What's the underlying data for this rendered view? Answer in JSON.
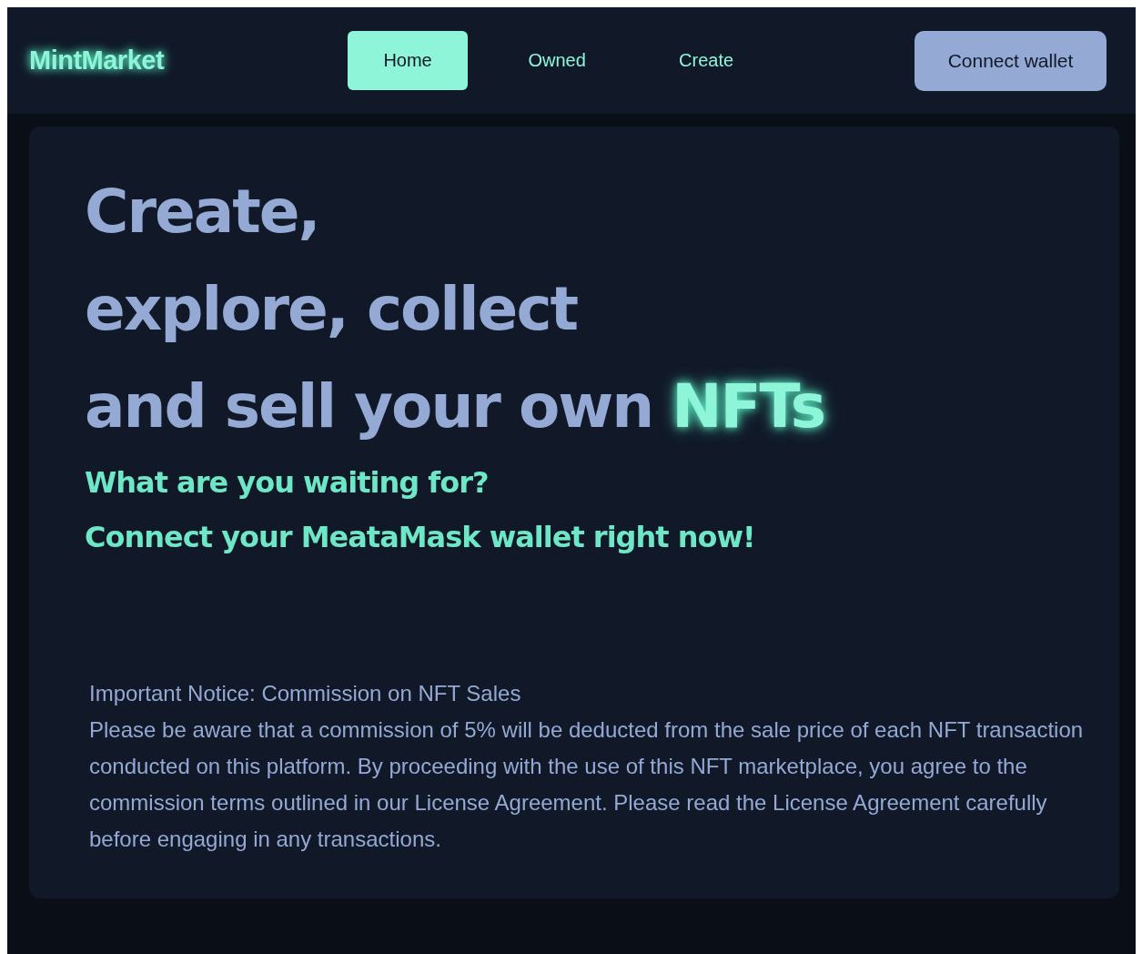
{
  "brand": "MintMarket",
  "nav": [
    {
      "label": "Home",
      "selected": true
    },
    {
      "label": "Owned",
      "selected": false
    },
    {
      "label": "Create",
      "selected": false
    }
  ],
  "connect_button": "Connect wallet",
  "headline": {
    "lines": [
      "Create,",
      "explore, collect",
      "and sell your own"
    ],
    "highlight": "NFTs"
  },
  "subheadings": [
    "What are you waiting for?",
    "Connect your MeataMask wallet right now!"
  ],
  "notice": {
    "title": "Important Notice: Commission on NFT Sales",
    "body": "Please be aware that a commission of 5% will be deducted from the sale price of each NFT transaction conducted on this platform. By proceeding with the use of this NFT marketplace, you agree to the commission terms outlined in our License Agreement. Please read the License Agreement carefully before engaging in any transactions."
  }
}
